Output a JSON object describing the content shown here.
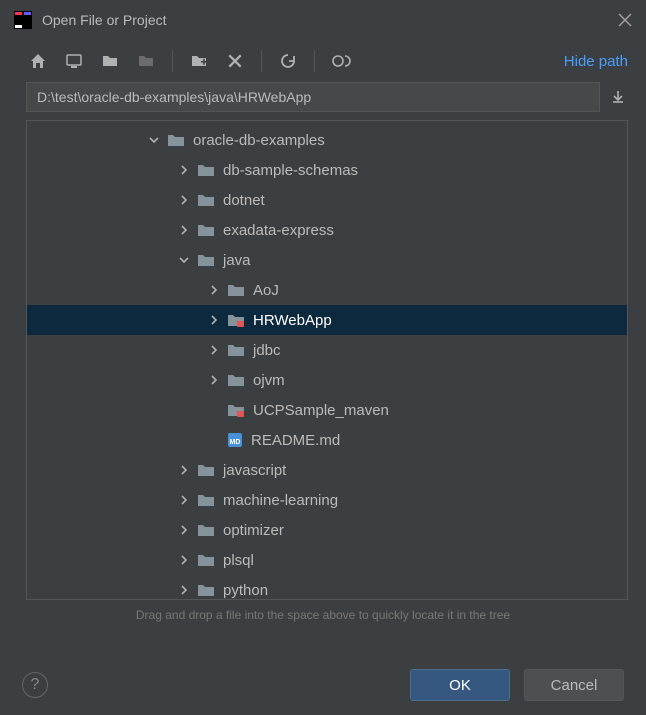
{
  "title": "Open File or Project",
  "hide_path_label": "Hide path",
  "path_value": "D:\\test\\oracle-db-examples\\java\\HRWebApp",
  "hint": "Drag and drop a file into the space above to quickly locate it in the tree",
  "ok_label": "OK",
  "cancel_label": "Cancel",
  "tree": [
    {
      "label": "oracle-db-examples",
      "indent": 120,
      "icon": "dir",
      "arrow": "down",
      "selected": false
    },
    {
      "label": "db-sample-schemas",
      "indent": 150,
      "icon": "dir",
      "arrow": "right",
      "selected": false
    },
    {
      "label": "dotnet",
      "indent": 150,
      "icon": "dir",
      "arrow": "right",
      "selected": false
    },
    {
      "label": "exadata-express",
      "indent": 150,
      "icon": "dir",
      "arrow": "right",
      "selected": false
    },
    {
      "label": "java",
      "indent": 150,
      "icon": "dir",
      "arrow": "down",
      "selected": false
    },
    {
      "label": "AoJ",
      "indent": 180,
      "icon": "dir",
      "arrow": "right",
      "selected": false
    },
    {
      "label": "HRWebApp",
      "indent": 180,
      "icon": "proj",
      "arrow": "right",
      "selected": true
    },
    {
      "label": "jdbc",
      "indent": 180,
      "icon": "dir",
      "arrow": "right",
      "selected": false
    },
    {
      "label": "ojvm",
      "indent": 180,
      "icon": "dir",
      "arrow": "right",
      "selected": false
    },
    {
      "label": "UCPSample_maven",
      "indent": 180,
      "icon": "proj",
      "arrow": "none",
      "selected": false
    },
    {
      "label": "README.md",
      "indent": 180,
      "icon": "md",
      "arrow": "none",
      "selected": false
    },
    {
      "label": "javascript",
      "indent": 150,
      "icon": "dir",
      "arrow": "right",
      "selected": false
    },
    {
      "label": "machine-learning",
      "indent": 150,
      "icon": "dir",
      "arrow": "right",
      "selected": false
    },
    {
      "label": "optimizer",
      "indent": 150,
      "icon": "dir",
      "arrow": "right",
      "selected": false
    },
    {
      "label": "plsql",
      "indent": 150,
      "icon": "dir",
      "arrow": "right",
      "selected": false
    },
    {
      "label": "python",
      "indent": 150,
      "icon": "dir",
      "arrow": "right",
      "selected": false
    }
  ]
}
